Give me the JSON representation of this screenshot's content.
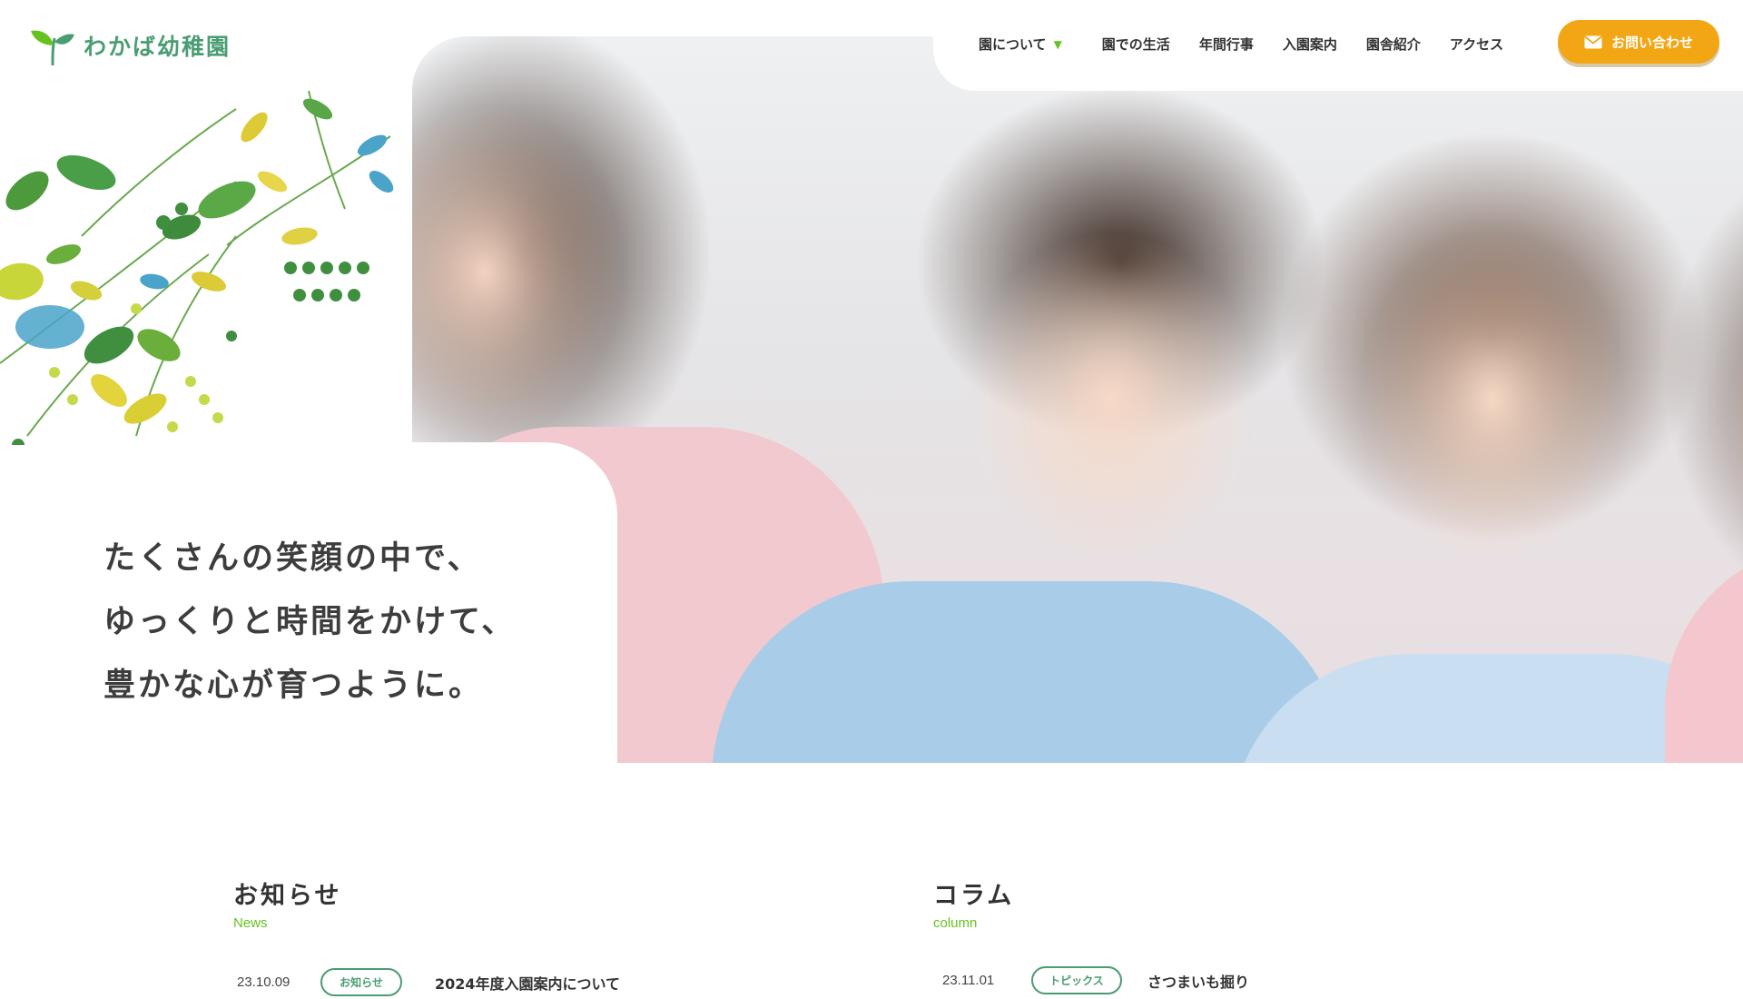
{
  "site": {
    "logo_text": "わかば幼稚園"
  },
  "nav": {
    "items": [
      {
        "label": "園について",
        "has_dropdown": true
      },
      {
        "label": "園での生活"
      },
      {
        "label": "年間行事"
      },
      {
        "label": "入園案内"
      },
      {
        "label": "園舎紹介"
      },
      {
        "label": "アクセス"
      }
    ],
    "contact_label": "お問い合わせ",
    "contact_icon": "mail-icon",
    "dropdown_icon": "chevron-down-icon"
  },
  "hero": {
    "catch_lines": [
      "たくさんの笑顔の中で、",
      "ゆっくりと時間をかけて、",
      "豊かな心が育つように。"
    ]
  },
  "news": {
    "title": "お知らせ",
    "subtitle": "News",
    "posts": [
      {
        "date": "23.10.09",
        "category": "お知らせ",
        "title": "2024年度入園案内について"
      }
    ]
  },
  "column": {
    "title": "コラム",
    "subtitle": "column",
    "posts": [
      {
        "date": "23.11.01",
        "category": "トピックス",
        "title": "さつまいも掘り"
      }
    ]
  },
  "colors": {
    "brand_green": "#4a9d72",
    "accent_lime": "#66c21f",
    "cta_orange": "#f3a613",
    "text": "#333333"
  }
}
